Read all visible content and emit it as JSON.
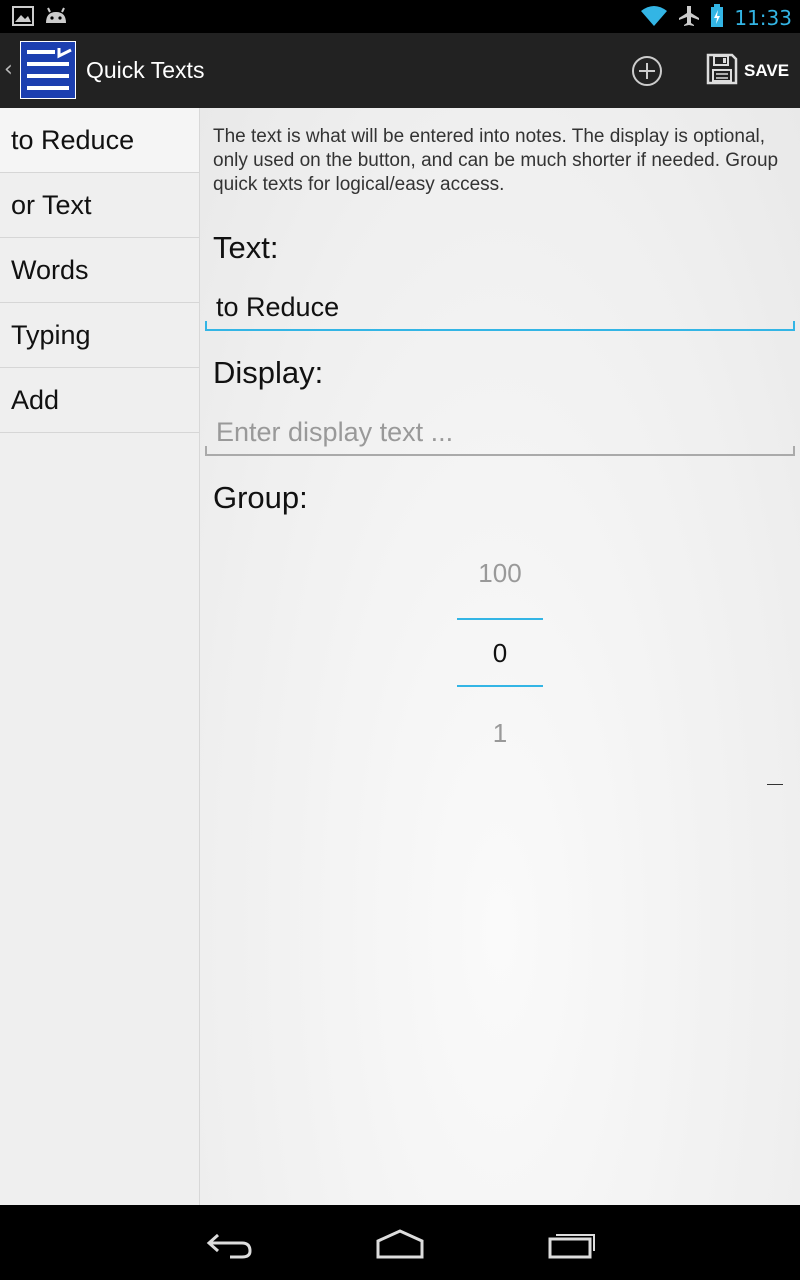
{
  "status_bar": {
    "time": "11:33",
    "icons": [
      "gallery-icon",
      "android-icon",
      "wifi-icon",
      "airplane-icon",
      "battery-icon"
    ]
  },
  "action_bar": {
    "title": "Quick Texts",
    "add_icon": "add-circle-icon",
    "save_label": "SAVE"
  },
  "sidebar": {
    "items": [
      {
        "label": "to Reduce"
      },
      {
        "label": "or Text"
      },
      {
        "label": "Words"
      },
      {
        "label": "Typing"
      },
      {
        "label": "Add"
      }
    ]
  },
  "main": {
    "help_text": "The text is what will be entered into notes. The display is optional, only used on the button, and can be much shorter if needed. Group quick texts for logical/easy access.",
    "text_label": "Text:",
    "text_value": "to Reduce",
    "display_label": "Display:",
    "display_placeholder": "Enter display text ...",
    "group_label": "Group:",
    "group_picker": {
      "prev": "100",
      "current": "0",
      "next": "1"
    }
  },
  "colors": {
    "accent": "#33b5e5",
    "action_bar": "#222222",
    "app_icon": "#1c3fb0"
  }
}
